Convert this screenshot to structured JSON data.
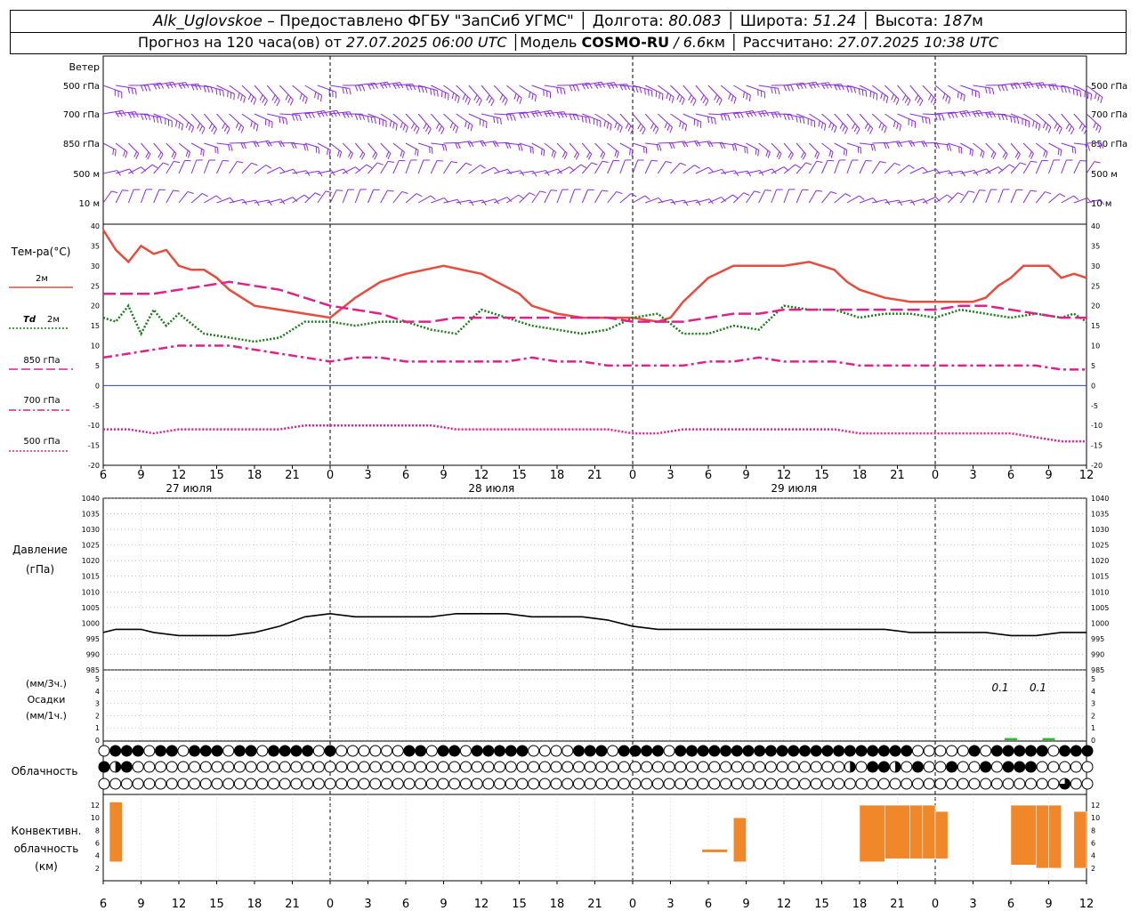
{
  "header": {
    "station": "Alk_Uglovskoe",
    "provider": "– Предоставлено ФГБУ \"ЗапСиб УГМС\"",
    "lon_label": "Долгота:",
    "lon_value": "80.083",
    "lat_label": "Широта:",
    "lat_value": "51.24",
    "alt_label": "Высота:",
    "alt_value": "187",
    "alt_unit": "м",
    "forecast_prefix": "Прогноз на 120 часа(ов) от",
    "forecast_time": "27.07.2025 06:00 UTC",
    "model_label": "Модель",
    "model_name": "COSMO-RU",
    "model_res": "/ 6.6",
    "model_res_unit": "км",
    "computed_label": "Рассчитано:",
    "computed_time": "27.07.2025 10:38 UTC"
  },
  "colors": {
    "t2m": "#e84c3d",
    "td2m": "#1a7a1a",
    "t850": "#e0208c",
    "t700": "#e0208c",
    "t500": "#e0208c",
    "pressure": "#000000",
    "wind": "#8a2be2",
    "precip": "#2db92d",
    "convective": "#f0882a"
  },
  "wind": {
    "title": "Ветер",
    "levels": [
      "500 гПа",
      "700 гПа",
      "850 гПа",
      "500 м",
      "10 м"
    ]
  },
  "temperature": {
    "title": "Тем-ра(°C)",
    "legend": {
      "t2m": "2м",
      "td_sym": "Td",
      "td_lvl": "2м",
      "t850": "850 гПа",
      "t700": "700 гПа",
      "t500": "500 гПа"
    }
  },
  "pressure": {
    "title_line1": "Давление",
    "title_line2": "(гПа)"
  },
  "precip": {
    "title_line1": "(мм/3ч.)",
    "title_line2": "Осадки",
    "title_line3": "(мм/1ч.)",
    "labels": [
      "0.1",
      "0.1"
    ]
  },
  "clouds": {
    "title": "Облачность"
  },
  "convective": {
    "title_line1": "Конвективн.",
    "title_line2": "облачность",
    "title_line3": "(км)"
  },
  "time_axis": {
    "hour_ticks": [
      "6",
      "9",
      "12",
      "15",
      "18",
      "21",
      "0",
      "3",
      "6",
      "9",
      "12",
      "15",
      "18",
      "21",
      "0",
      "3",
      "6",
      "9",
      "12",
      "15",
      "18",
      "21",
      "0",
      "3",
      "6",
      "9",
      "12"
    ],
    "days": [
      "27 июля",
      "28 июля",
      "29 июля"
    ]
  },
  "chart_data": {
    "type": "line",
    "x_unit": "hours since 27.07.2025 06:00 UTC",
    "xlim": [
      0,
      78
    ],
    "panels": {
      "temperature": {
        "ylabel": "Тем-ра(°C)",
        "ylim": [
          -20,
          40
        ],
        "yticks": [
          -20,
          -15,
          -10,
          -5,
          0,
          5,
          10,
          15,
          20,
          25,
          30,
          35,
          40
        ],
        "series": [
          {
            "name": "2м",
            "style": "solid",
            "x": [
              0,
              1,
              2,
              3,
              4,
              5,
              6,
              7,
              8,
              9,
              10,
              12,
              14,
              16,
              18,
              20,
              21,
              22,
              24,
              27,
              30,
              33,
              34,
              36,
              38,
              40,
              42,
              44,
              45,
              46,
              48,
              50,
              52,
              54,
              56,
              57,
              58,
              59,
              60,
              62,
              64,
              66,
              68,
              69,
              70,
              71,
              72,
              73,
              74,
              75,
              76,
              77,
              78
            ],
            "values": [
              39,
              34,
              31,
              35,
              33,
              34,
              30,
              29,
              29,
              27,
              24,
              20,
              19,
              18,
              17,
              22,
              24,
              26,
              28,
              30,
              28,
              23,
              20,
              18,
              17,
              17,
              17,
              16,
              17,
              21,
              27,
              30,
              30,
              30,
              31,
              30,
              29,
              26,
              24,
              22,
              21,
              21,
              21,
              21,
              22,
              25,
              27,
              30,
              30,
              30,
              27,
              28,
              27
            ]
          },
          {
            "name": "Td 2м",
            "style": "dotted",
            "x": [
              0,
              1,
              2,
              3,
              4,
              5,
              6,
              8,
              10,
              12,
              14,
              16,
              18,
              20,
              22,
              24,
              26,
              28,
              30,
              32,
              34,
              36,
              38,
              40,
              42,
              44,
              46,
              48,
              50,
              52,
              54,
              56,
              58,
              60,
              62,
              64,
              66,
              68,
              70,
              72,
              74,
              76,
              77,
              78
            ],
            "values": [
              17,
              16,
              20,
              13,
              19,
              15,
              18,
              13,
              12,
              11,
              12,
              16,
              16,
              15,
              16,
              16,
              14,
              13,
              19,
              17,
              15,
              14,
              13,
              14,
              17,
              18,
              13,
              13,
              15,
              14,
              20,
              19,
              19,
              17,
              18,
              18,
              17,
              19,
              18,
              17,
              18,
              17,
              18,
              16
            ]
          },
          {
            "name": "850 гПа",
            "style": "long-dash",
            "x": [
              0,
              2,
              4,
              6,
              8,
              10,
              12,
              14,
              16,
              18,
              20,
              22,
              24,
              26,
              28,
              30,
              32,
              34,
              36,
              38,
              40,
              42,
              44,
              46,
              48,
              50,
              52,
              54,
              56,
              58,
              60,
              62,
              64,
              66,
              68,
              70,
              72,
              74,
              76,
              78
            ],
            "values": [
              23,
              23,
              23,
              24,
              25,
              26,
              25,
              24,
              22,
              20,
              19,
              18,
              16,
              16,
              17,
              17,
              17,
              17,
              17,
              17,
              17,
              16,
              16,
              16,
              17,
              18,
              18,
              19,
              19,
              19,
              19,
              19,
              19,
              19,
              20,
              20,
              19,
              18,
              17,
              17
            ]
          },
          {
            "name": "700 гПа",
            "style": "dash-dot",
            "x": [
              0,
              2,
              4,
              6,
              8,
              10,
              12,
              14,
              16,
              18,
              20,
              22,
              24,
              26,
              28,
              30,
              32,
              34,
              36,
              38,
              40,
              42,
              44,
              46,
              48,
              50,
              52,
              54,
              56,
              58,
              60,
              62,
              64,
              66,
              68,
              70,
              72,
              74,
              76,
              78
            ],
            "values": [
              7,
              8,
              9,
              10,
              10,
              10,
              9,
              8,
              7,
              6,
              7,
              7,
              6,
              6,
              6,
              6,
              6,
              7,
              6,
              6,
              5,
              5,
              5,
              5,
              6,
              6,
              7,
              6,
              6,
              6,
              5,
              5,
              5,
              5,
              5,
              5,
              5,
              5,
              4,
              4
            ]
          },
          {
            "name": "500 гПа",
            "style": "dotted",
            "x": [
              0,
              2,
              4,
              6,
              8,
              10,
              12,
              14,
              16,
              18,
              20,
              22,
              24,
              26,
              28,
              30,
              32,
              34,
              36,
              38,
              40,
              42,
              44,
              46,
              48,
              50,
              52,
              54,
              56,
              58,
              60,
              62,
              64,
              66,
              68,
              70,
              72,
              74,
              76,
              78
            ],
            "values": [
              -11,
              -11,
              -12,
              -11,
              -11,
              -11,
              -11,
              -11,
              -10,
              -10,
              -10,
              -10,
              -10,
              -10,
              -11,
              -11,
              -11,
              -11,
              -11,
              -11,
              -11,
              -12,
              -12,
              -11,
              -11,
              -11,
              -11,
              -11,
              -11,
              -11,
              -12,
              -12,
              -12,
              -12,
              -12,
              -12,
              -12,
              -13,
              -14,
              -14
            ]
          }
        ]
      },
      "pressure": {
        "ylabel": "Давление (гПа)",
        "ylim": [
          985,
          1040
        ],
        "yticks": [
          985,
          990,
          995,
          1000,
          1005,
          1010,
          1015,
          1020,
          1025,
          1030,
          1035,
          1040
        ],
        "series": [
          {
            "name": "",
            "x": [
              0,
              1,
              2,
              3,
              4,
              6,
              8,
              10,
              12,
              14,
              16,
              18,
              20,
              22,
              24,
              26,
              28,
              30,
              32,
              34,
              36,
              38,
              40,
              42,
              44,
              46,
              48,
              50,
              52,
              54,
              56,
              58,
              60,
              62,
              64,
              66,
              68,
              70,
              72,
              74,
              76,
              78
            ],
            "values": [
              997,
              998,
              998,
              998,
              997,
              996,
              996,
              996,
              997,
              999,
              1002,
              1003,
              1002,
              1002,
              1002,
              1002,
              1003,
              1003,
              1003,
              1002,
              1002,
              1002,
              1001,
              999,
              998,
              998,
              998,
              998,
              998,
              998,
              998,
              998,
              998,
              998,
              997,
              997,
              997,
              997,
              996,
              996,
              997,
              997
            ]
          }
        ]
      },
      "precipitation": {
        "ylabel": "Осадки (мм/3ч.) (мм/1ч.)",
        "ylim": [
          0,
          5
        ],
        "yticks": [
          0,
          1,
          2,
          3,
          4,
          5
        ],
        "x": [
          72,
          75
        ],
        "values": [
          0.1,
          0.1
        ]
      },
      "convective_cloud": {
        "ylabel": "Конвективн. облачность (км)",
        "ylim": [
          0,
          12
        ],
        "yticks": [
          2,
          4,
          6,
          8,
          10,
          12
        ],
        "bars": [
          {
            "x0": 0.5,
            "x1": 1.5,
            "base": 3,
            "top": 12.5
          },
          {
            "x0": 47.5,
            "x1": 49.5,
            "base": 4.5,
            "top": 5
          },
          {
            "x0": 50,
            "x1": 51,
            "base": 3,
            "top": 10
          },
          {
            "x0": 60,
            "x1": 62,
            "base": 3,
            "top": 12
          },
          {
            "x0": 62,
            "x1": 64,
            "base": 3.5,
            "top": 12
          },
          {
            "x0": 64,
            "x1": 65,
            "base": 3.5,
            "top": 12
          },
          {
            "x0": 65,
            "x1": 66,
            "base": 3.5,
            "top": 12
          },
          {
            "x0": 66,
            "x1": 67,
            "base": 3.5,
            "top": 11
          },
          {
            "x0": 72,
            "x1": 74,
            "base": 2.5,
            "top": 12
          },
          {
            "x0": 74,
            "x1": 75,
            "base": 2,
            "top": 12
          },
          {
            "x0": 75,
            "x1": 76,
            "base": 2,
            "top": 12
          },
          {
            "x0": 77,
            "x1": 78,
            "base": 2,
            "top": 11
          }
        ]
      }
    },
    "wind_levels": [
      "500 гПа",
      "700 гПа",
      "850 гПа",
      "500 м",
      "10 м"
    ],
    "cloud_rows": [
      "0111011011101101111010000001101101111100001110111101111111111111111111110000010111110111",
      "1210000000000000000000000000000000000000000000000000000000000000002011201001001011100000",
      "0000000000000000000000000000000000000000000000000000000000000000000000000000000000000300"
    ]
  }
}
